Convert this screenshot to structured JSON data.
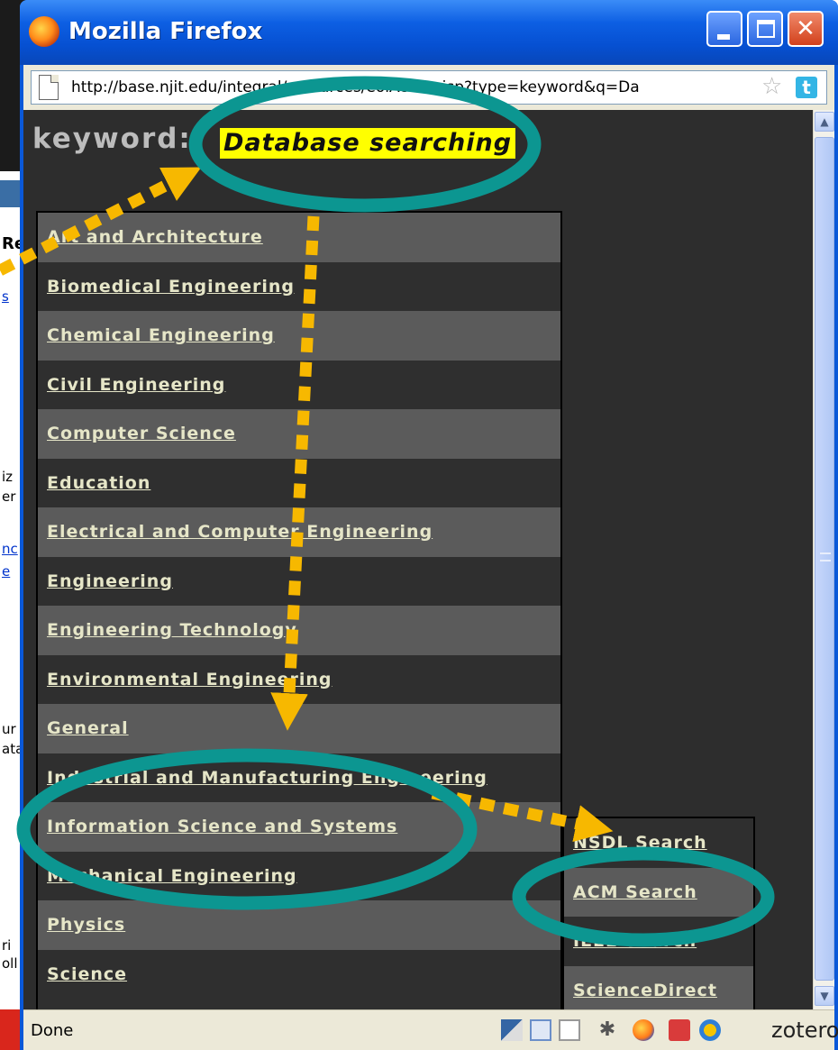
{
  "window": {
    "title": "Mozilla Firefox"
  },
  "address_bar": {
    "url": "http://base.njit.edu/integral/resources/eoiAction.jsp?type=keyword&q=Da"
  },
  "content": {
    "keyword_label": "keyword:",
    "keyword_value": "Database searching",
    "subjects": [
      "Art and Architecture",
      "Biomedical Engineering",
      "Chemical Engineering",
      "Civil Engineering",
      "Computer Science",
      "Education",
      "Electrical and Computer Engineering",
      "Engineering",
      "Engineering Technology",
      "Environmental Engineering",
      "General",
      "Industrial and Manufacturing Engineering",
      "Information Science and Systems",
      "Mechanical Engineering",
      "Physics",
      "Science"
    ],
    "search_tools": [
      "NSDL Search",
      "ACM Search",
      "IEEE Search",
      "ScienceDirect"
    ]
  },
  "status_bar": {
    "status_text": "Done",
    "zotero_label": "zotero"
  },
  "background_page": {
    "fragments": [
      "Re",
      "s",
      "iz",
      "er",
      "nc",
      "e",
      "ur",
      "ata",
      "ri",
      "oll"
    ]
  },
  "colors": {
    "titlebar": "#0a58d8",
    "content_bg": "#2d2d2d",
    "row_light": "#5b5b5b",
    "highlight": "#ffff00",
    "annotation_arrow": "#f7b800",
    "annotation_ellipse": "#0c9691"
  },
  "icons": {
    "window": "firefox-icon",
    "address": "page-icon",
    "bookmark": "star-icon",
    "extension": "twitter-icon"
  }
}
